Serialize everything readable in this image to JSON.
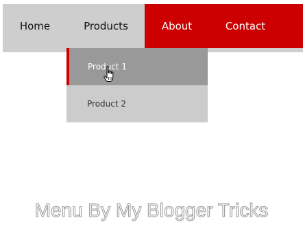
{
  "nav": {
    "items": [
      {
        "label": "Home"
      },
      {
        "label": "Products"
      },
      {
        "label": "About"
      },
      {
        "label": "Contact"
      }
    ],
    "colors": {
      "bar": "#cecece",
      "accent": "#cc0000"
    }
  },
  "dropdown": {
    "items": [
      {
        "label": "Product 1",
        "state": "hovered"
      },
      {
        "label": "Product 2",
        "state": "normal"
      }
    ]
  },
  "footer": {
    "text": "Menu By My Blogger Tricks"
  },
  "icons": {
    "cursor": "hand-pointer-icon"
  }
}
